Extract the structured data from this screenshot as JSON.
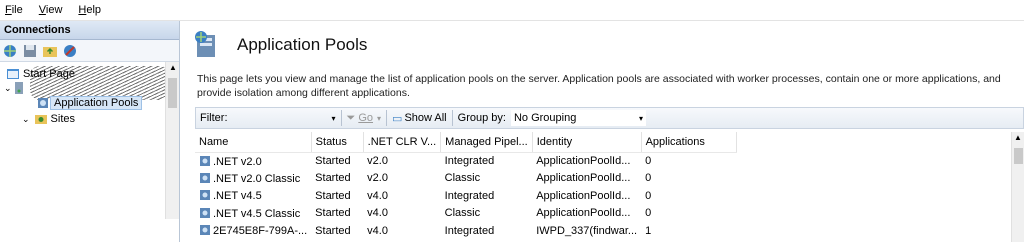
{
  "menu": {
    "file": "File",
    "view": "View",
    "help": "Help"
  },
  "connections": {
    "title": "Connections",
    "tree": {
      "start_page": "Start Page",
      "app_pools": "Application Pools",
      "sites": "Sites"
    }
  },
  "page": {
    "title": "Application Pools",
    "description": "This page lets you view and manage the list of application pools on the server. Application pools are associated with worker processes, contain one or more applications, and provide isolation among different applications."
  },
  "filterbar": {
    "filter_label": "Filter:",
    "go_label": "Go",
    "show_all_label": "Show All",
    "group_by_label": "Group by:",
    "group_by_value": "No Grouping"
  },
  "table": {
    "columns": [
      "Name",
      "Status",
      ".NET CLR V...",
      "Managed Pipel...",
      "Identity",
      "Applications"
    ],
    "rows": [
      {
        "name": ".NET v2.0",
        "status": "Started",
        "clr": "v2.0",
        "pipeline": "Integrated",
        "identity": "ApplicationPoolId...",
        "apps": "0"
      },
      {
        "name": ".NET v2.0 Classic",
        "status": "Started",
        "clr": "v2.0",
        "pipeline": "Classic",
        "identity": "ApplicationPoolId...",
        "apps": "0"
      },
      {
        "name": ".NET v4.5",
        "status": "Started",
        "clr": "v4.0",
        "pipeline": "Integrated",
        "identity": "ApplicationPoolId...",
        "apps": "0"
      },
      {
        "name": ".NET v4.5 Classic",
        "status": "Started",
        "clr": "v4.0",
        "pipeline": "Classic",
        "identity": "ApplicationPoolId...",
        "apps": "0"
      },
      {
        "name": "2E745E8F-799A-...",
        "status": "Started",
        "clr": "v4.0",
        "pipeline": "Integrated",
        "identity": "IWPD_337(findwar...",
        "apps": "1"
      }
    ]
  }
}
